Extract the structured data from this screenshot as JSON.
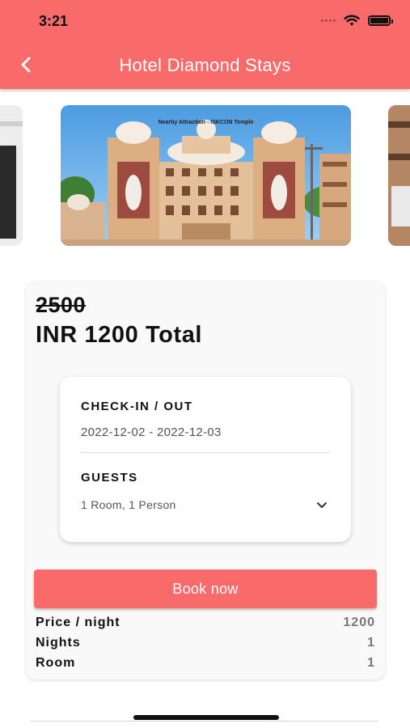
{
  "status_bar": {
    "time": "3:21",
    "icons": [
      "signal-dots-icon",
      "wifi-icon",
      "battery-icon"
    ]
  },
  "header": {
    "title": "Hotel Diamond Stays",
    "back_icon": "chevron-left-icon",
    "color": "#f96b6b"
  },
  "carousel": {
    "main_caption": "Nearby Attraction - ISKCON Temple"
  },
  "pricing": {
    "original_price": "2500",
    "total": "INR 1200 Total"
  },
  "booking": {
    "checkin_label": "CHECK-IN / OUT",
    "checkin_value": "2022-12-02 - 2022-12-03",
    "guests_label": "GUESTS",
    "guests_value": "1 Room, 1 Person",
    "dropdown_icon": "chevron-down-icon"
  },
  "actions": {
    "book_label": "Book now"
  },
  "summary": [
    {
      "label": "Price / night",
      "value": "1200"
    },
    {
      "label": "Nights",
      "value": "1"
    },
    {
      "label": "Room",
      "value": "1"
    }
  ]
}
